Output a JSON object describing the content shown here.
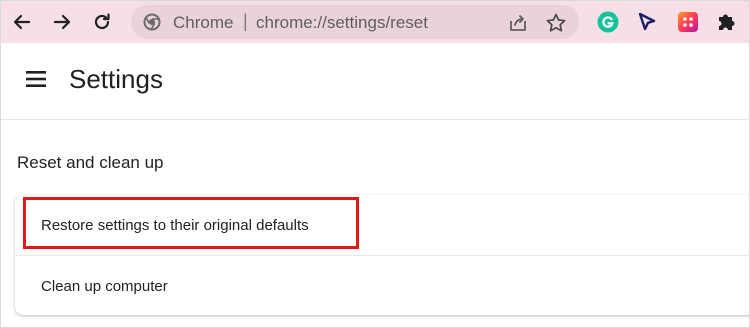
{
  "browser": {
    "omnibox": {
      "site_label": "Chrome",
      "separator": "|",
      "url": "chrome://settings/reset"
    },
    "icons": {
      "back": "back-arrow-icon",
      "forward": "forward-arrow-icon",
      "reload": "reload-icon",
      "site": "chrome-site-icon",
      "share": "share-icon",
      "bookmark": "bookmark-star-icon",
      "ext1": "grammarly-icon",
      "ext2": "cursor-pointer-icon",
      "ext3": "color-picker-extension-icon",
      "ext4": "extensions-puzzle-icon"
    },
    "colors": {
      "toolbar_bg": "#f6dfe6",
      "omnibox_bg": "#ead2d9",
      "grammarly": "#15c39a",
      "highlight": "#e01818"
    }
  },
  "settings": {
    "title": "Settings",
    "section_title": "Reset and clean up",
    "items": [
      {
        "label": "Restore settings to their original defaults"
      },
      {
        "label": "Clean up computer"
      }
    ]
  }
}
